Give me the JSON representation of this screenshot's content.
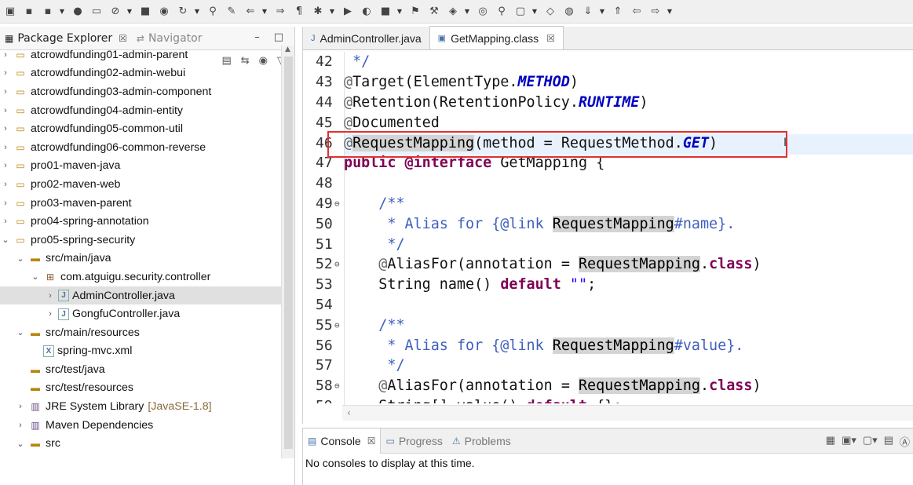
{
  "toolbar": {
    "icons": [
      "new-icon",
      "save-icon",
      "save-all-icon",
      "debug-icon",
      "console-icon",
      "skip-breakpoints-icon",
      "terminate-icon",
      "toggle-mark-icon",
      "refresh-icon",
      "pin-icon",
      "edit-icon",
      "prev-annotation-icon",
      "next-annotation-icon",
      "show-whitespace-icon",
      "debug-run-icon",
      "run-icon",
      "coverage-icon",
      "stop-icon",
      "ant-icon",
      "build-icon",
      "open-type-icon",
      "open-task-icon",
      "search-icon",
      "open-folder-icon",
      "web-browser-icon",
      "globe-icon",
      "next-edit-icon",
      "prev-edit-icon",
      "back-icon",
      "forward-icon"
    ]
  },
  "left_panel": {
    "tabs": [
      {
        "label": "Package Explorer",
        "close": "☒",
        "active": true
      },
      {
        "label": "Navigator",
        "active": false
      }
    ],
    "min_btn": "–",
    "max_btn": "□",
    "tree": [
      {
        "indent": 0,
        "twisty": "›",
        "icon": "project",
        "label": "atcrowdfunding01-admin-parent"
      },
      {
        "indent": 0,
        "twisty": "›",
        "icon": "maven-project",
        "label": "atcrowdfunding02-admin-webui"
      },
      {
        "indent": 0,
        "twisty": "›",
        "icon": "maven-project",
        "label": "atcrowdfunding03-admin-component"
      },
      {
        "indent": 0,
        "twisty": "›",
        "icon": "maven-project",
        "label": "atcrowdfunding04-admin-entity"
      },
      {
        "indent": 0,
        "twisty": "›",
        "icon": "maven-project",
        "label": "atcrowdfunding05-common-util"
      },
      {
        "indent": 0,
        "twisty": "›",
        "icon": "maven-project",
        "label": "atcrowdfunding06-common-reverse"
      },
      {
        "indent": 0,
        "twisty": "›",
        "icon": "project",
        "label": "pro01-maven-java"
      },
      {
        "indent": 0,
        "twisty": "›",
        "icon": "maven-project",
        "label": "pro02-maven-web"
      },
      {
        "indent": 0,
        "twisty": "›",
        "icon": "maven-project",
        "label": "pro03-maven-parent"
      },
      {
        "indent": 0,
        "twisty": "›",
        "icon": "project",
        "label": "pro04-spring-annotation"
      },
      {
        "indent": 0,
        "twisty": "⌄",
        "icon": "project",
        "label": "pro05-spring-security"
      },
      {
        "indent": 1,
        "twisty": "⌄",
        "icon": "source-folder",
        "label": "src/main/java"
      },
      {
        "indent": 2,
        "twisty": "⌄",
        "icon": "package",
        "label": "com.atguigu.security.controller"
      },
      {
        "indent": 3,
        "twisty": "›",
        "icon": "java-file",
        "label": "AdminController.java",
        "selected": true
      },
      {
        "indent": 3,
        "twisty": "›",
        "icon": "java-file",
        "label": "GongfuController.java"
      },
      {
        "indent": 1,
        "twisty": "⌄",
        "icon": "source-folder",
        "label": "src/main/resources"
      },
      {
        "indent": 2,
        "twisty": "",
        "icon": "xml-file",
        "label": "spring-mvc.xml"
      },
      {
        "indent": 1,
        "twisty": "",
        "icon": "source-folder",
        "label": "src/test/java"
      },
      {
        "indent": 1,
        "twisty": "",
        "icon": "source-folder",
        "label": "src/test/resources"
      },
      {
        "indent": 1,
        "twisty": "›",
        "icon": "library",
        "label": "JRE System Library",
        "deco": "[JavaSE-1.8]"
      },
      {
        "indent": 1,
        "twisty": "›",
        "icon": "library",
        "label": "Maven Dependencies"
      },
      {
        "indent": 1,
        "twisty": "⌄",
        "icon": "folder",
        "label": "src"
      }
    ]
  },
  "editor": {
    "tabs": [
      {
        "label": "AdminController.java",
        "active": false
      },
      {
        "label": "GetMapping.class",
        "close": "☒",
        "active": true
      }
    ],
    "hscroll_arrow": "‹",
    "lines": [
      {
        "n": "42",
        "fold": false,
        "parts": [
          [
            "tx",
            " "
          ],
          [
            "cm",
            "*/"
          ]
        ]
      },
      {
        "n": "43",
        "fold": false,
        "parts": [
          [
            "an",
            "@"
          ],
          [
            "tx",
            "Target(ElementType."
          ],
          [
            "it",
            "METHOD"
          ],
          [
            "tx",
            ")"
          ]
        ]
      },
      {
        "n": "44",
        "fold": false,
        "parts": [
          [
            "an",
            "@"
          ],
          [
            "tx",
            "Retention(RetentionPolicy."
          ],
          [
            "it",
            "RUNTIME"
          ],
          [
            "tx",
            ")"
          ]
        ]
      },
      {
        "n": "45",
        "fold": false,
        "parts": [
          [
            "an",
            "@"
          ],
          [
            "tx",
            "Documented"
          ]
        ]
      },
      {
        "n": "46",
        "fold": false,
        "parts": [
          [
            "an",
            "@"
          ],
          [
            "hl",
            "RequestMapping"
          ],
          [
            "tx",
            "(method = RequestMethod."
          ],
          [
            "it",
            "GET"
          ],
          [
            "tx",
            ")"
          ]
        ]
      },
      {
        "n": "47",
        "fold": false,
        "parts": [
          [
            "kw",
            "public"
          ],
          [
            "tx",
            " "
          ],
          [
            "kw",
            "@interface"
          ],
          [
            "tx",
            " GetMapping {"
          ]
        ]
      },
      {
        "n": "48",
        "fold": false,
        "parts": []
      },
      {
        "n": "49",
        "fold": true,
        "parts": [
          [
            "tx",
            "    "
          ],
          [
            "cm",
            "/**"
          ]
        ]
      },
      {
        "n": "50",
        "fold": false,
        "parts": [
          [
            "tx",
            "     "
          ],
          [
            "cm",
            "* Alias for {@link "
          ],
          [
            "hl",
            "RequestMapping"
          ],
          [
            "cm",
            "#name}."
          ]
        ]
      },
      {
        "n": "51",
        "fold": false,
        "parts": [
          [
            "tx",
            "     "
          ],
          [
            "cm",
            "*/"
          ]
        ]
      },
      {
        "n": "52",
        "fold": true,
        "parts": [
          [
            "tx",
            "    "
          ],
          [
            "an",
            "@"
          ],
          [
            "tx",
            "AliasFor(annotation = "
          ],
          [
            "hl",
            "RequestMapping"
          ],
          [
            "tx",
            "."
          ],
          [
            "kw",
            "class"
          ],
          [
            "tx",
            ")"
          ]
        ]
      },
      {
        "n": "53",
        "fold": false,
        "parts": [
          [
            "tx",
            "    String name() "
          ],
          [
            "kw",
            "default"
          ],
          [
            "tx",
            " "
          ],
          [
            "str",
            "\"\""
          ],
          [
            "tx",
            ";"
          ]
        ]
      },
      {
        "n": "54",
        "fold": false,
        "parts": []
      },
      {
        "n": "55",
        "fold": true,
        "parts": [
          [
            "tx",
            "    "
          ],
          [
            "cm",
            "/**"
          ]
        ]
      },
      {
        "n": "56",
        "fold": false,
        "parts": [
          [
            "tx",
            "     "
          ],
          [
            "cm",
            "* Alias for {@link "
          ],
          [
            "hl",
            "RequestMapping"
          ],
          [
            "cm",
            "#value}."
          ]
        ]
      },
      {
        "n": "57",
        "fold": false,
        "parts": [
          [
            "tx",
            "     "
          ],
          [
            "cm",
            "*/"
          ]
        ]
      },
      {
        "n": "58",
        "fold": true,
        "parts": [
          [
            "tx",
            "    "
          ],
          [
            "an",
            "@"
          ],
          [
            "tx",
            "AliasFor(annotation = "
          ],
          [
            "hl",
            "RequestMapping"
          ],
          [
            "tx",
            "."
          ],
          [
            "kw",
            "class"
          ],
          [
            "tx",
            ")"
          ]
        ]
      },
      {
        "n": "59",
        "fold": false,
        "parts": [
          [
            "tx",
            "    String[] value() "
          ],
          [
            "kw",
            "default"
          ],
          [
            "tx",
            " {};"
          ]
        ]
      }
    ]
  },
  "console": {
    "tabs": [
      {
        "label": "Console",
        "close": "☒",
        "active": true
      },
      {
        "label": "Progress",
        "active": false
      },
      {
        "label": "Problems",
        "active": false
      }
    ],
    "message": "No consoles to display at this time."
  }
}
